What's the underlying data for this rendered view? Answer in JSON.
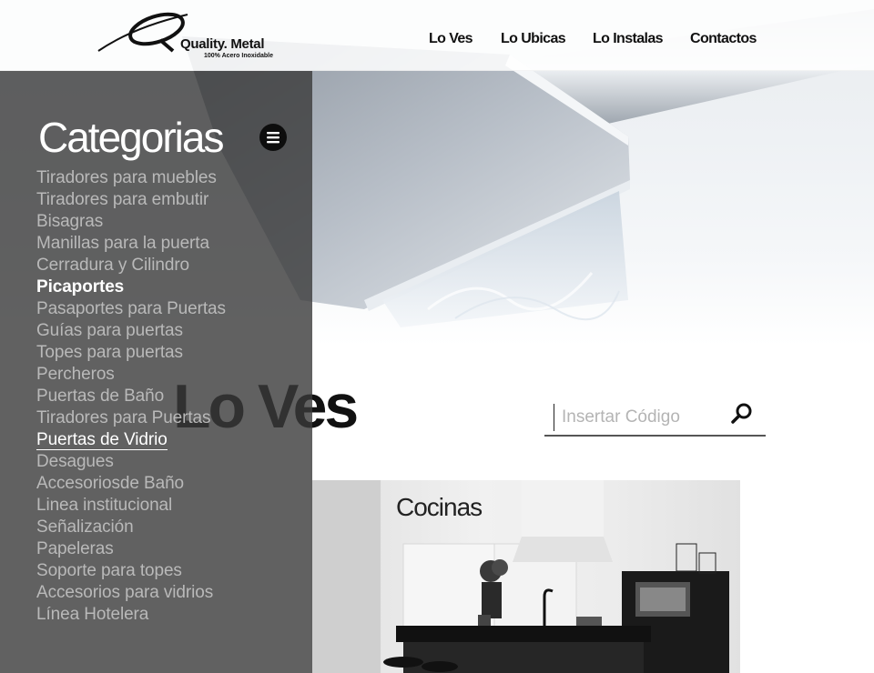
{
  "header": {
    "logo": {
      "name": "Quality. Metal",
      "tagline": "100% Acero Inoxidable"
    },
    "nav": [
      {
        "label": "Lo Ves"
      },
      {
        "label": "Lo Ubicas"
      },
      {
        "label": "Lo Instalas"
      },
      {
        "label": "Contactos"
      }
    ]
  },
  "section": {
    "heading": "Lo Ves"
  },
  "search": {
    "placeholder": "Insertar Código"
  },
  "card": {
    "title": "Cocinas"
  },
  "categories": {
    "title": "Categorias",
    "items": [
      {
        "label": "Tiradores para muebles"
      },
      {
        "label": "Tiradores para embutir"
      },
      {
        "label": "Bisagras"
      },
      {
        "label": "Manillas para la puerta"
      },
      {
        "label": "Cerradura y Cilindro"
      },
      {
        "label": "Picaportes",
        "state": "active"
      },
      {
        "label": "Pasaportes para Puertas"
      },
      {
        "label": "Guías para puertas"
      },
      {
        "label": "Topes para puertas"
      },
      {
        "label": "Percheros"
      },
      {
        "label": "Puertas de Baño"
      },
      {
        "label": "Tiradores para Puertas"
      },
      {
        "label": "Puertas de Vidrio",
        "state": "hover"
      },
      {
        "label": "Desagues"
      },
      {
        "label": "Accesoriosde Baño"
      },
      {
        "label": "Linea institucional"
      },
      {
        "label": "Señalización"
      },
      {
        "label": "Papeleras"
      },
      {
        "label": "Soporte para topes"
      },
      {
        "label": "Accesorios para vidrios"
      },
      {
        "label": "Línea Hotelera"
      }
    ]
  },
  "colors": {
    "panel": "#3a3a3a",
    "text_dark": "#111111",
    "category_text": "#b9b9b9",
    "active_text": "#ffffff"
  },
  "icons": {
    "menu": "hamburger-icon",
    "search": "magnifier-icon"
  }
}
